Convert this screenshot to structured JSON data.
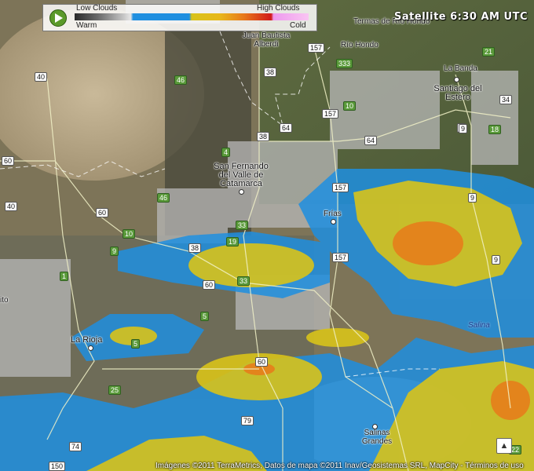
{
  "legend": {
    "top_left": "Low Clouds",
    "top_right": "High Clouds",
    "bottom_left": "Warm",
    "bottom_right": "Cold"
  },
  "status": {
    "text": "Satellite  6:30 AM UTC"
  },
  "credits": {
    "text": "Imágenes ©2011 TerraMetrics, Datos de mapa ©2011 Inav/Geosistemas SRL, MapCity - Términos de uso"
  },
  "places": {
    "termas": "Termas de Río Hondo",
    "rio_hondo": "Río Hondo",
    "juan_bautista": "Juan Bautista Alberdi",
    "la_banda": "La Banda",
    "santiago": "Santiago del Estero",
    "catamarca": "San Fernando del Valle de Catamarca",
    "frias": "Frías",
    "la_rioja": "La Rioja",
    "salina": "Salina",
    "salinas_grandes": "Salinas Grandes",
    "edge_ito": "ito"
  },
  "routes": [
    "157",
    "333",
    "21",
    "38",
    "40",
    "46",
    "10",
    "34",
    "64",
    "9",
    "18",
    "4",
    "60",
    "157",
    "157",
    "46",
    "40",
    "60",
    "10",
    "9",
    "1",
    "38",
    "19",
    "33",
    "33",
    "60",
    "5",
    "5",
    "25",
    "157",
    "60",
    "9",
    "9",
    "79",
    "74",
    "150",
    "22",
    "38",
    "64",
    "9"
  ],
  "colors": {
    "blue": "#1f8fe0",
    "yellow": "#d8c31a",
    "orange": "#e87a1a",
    "play": "#5b9a2a"
  }
}
